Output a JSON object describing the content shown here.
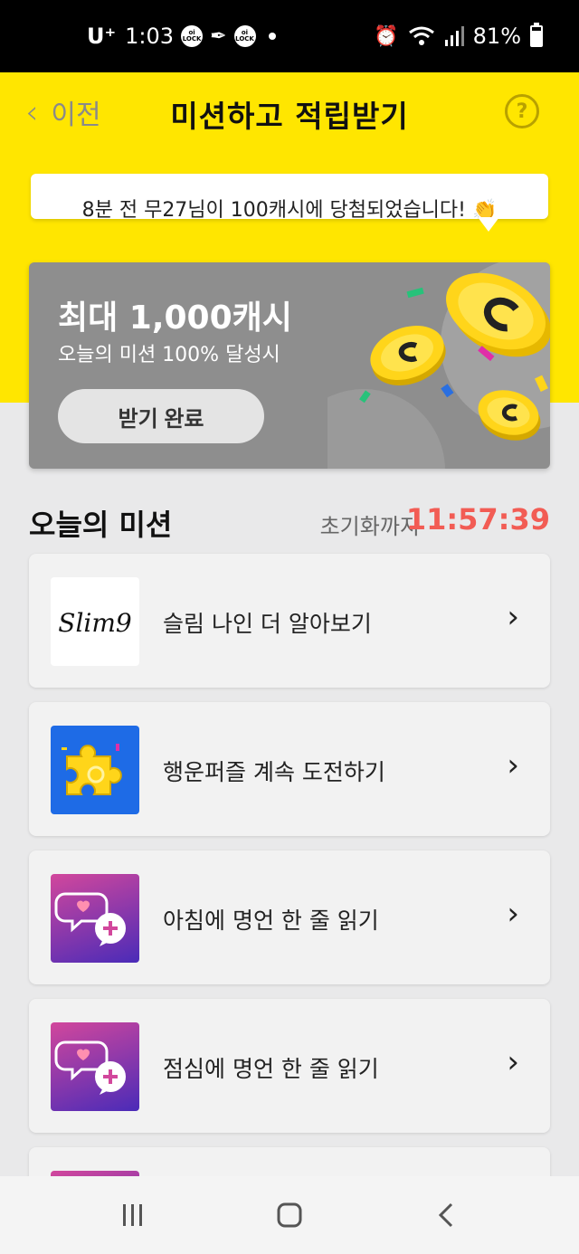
{
  "status_bar": {
    "carrier": "U⁺",
    "time": "1:03",
    "badges": [
      "oi LOCK",
      "oi LOCK"
    ],
    "battery": "81%",
    "battery_level": 0.81,
    "icons": [
      "alarm-icon",
      "wifi-icon",
      "signal-icon",
      "battery-icon"
    ]
  },
  "app_bar": {
    "back_label": "이전",
    "title": "미션하고 적립받기",
    "help_label": "?"
  },
  "ticker": {
    "text": "8분 전 무27님이 100캐시에 당첨되었습니다! 👏"
  },
  "banner": {
    "title": "최대 1,000캐시",
    "subtitle": "오늘의 미션 100% 달성시",
    "button_label": "받기 완료"
  },
  "missions_section": {
    "title": "오늘의 미션",
    "reset_label": "초기화까지",
    "reset_timer": "11:57:39"
  },
  "missions": [
    {
      "label": "슬림 나인 더 알아보기",
      "thumb_text": "Slim9",
      "icon": "slim9-logo"
    },
    {
      "label": "행운퍼즐 계속 도전하기",
      "icon": "puzzle-icon"
    },
    {
      "label": "아침에 명언 한 줄 읽기",
      "icon": "chat-bubbles-icon"
    },
    {
      "label": "점심에 명언 한 줄 읽기",
      "icon": "chat-bubbles-icon"
    }
  ],
  "colors": {
    "brand_yellow": "#ffe600",
    "timer_red": "#f25c54",
    "banner_gray": "#8e8e8e"
  }
}
